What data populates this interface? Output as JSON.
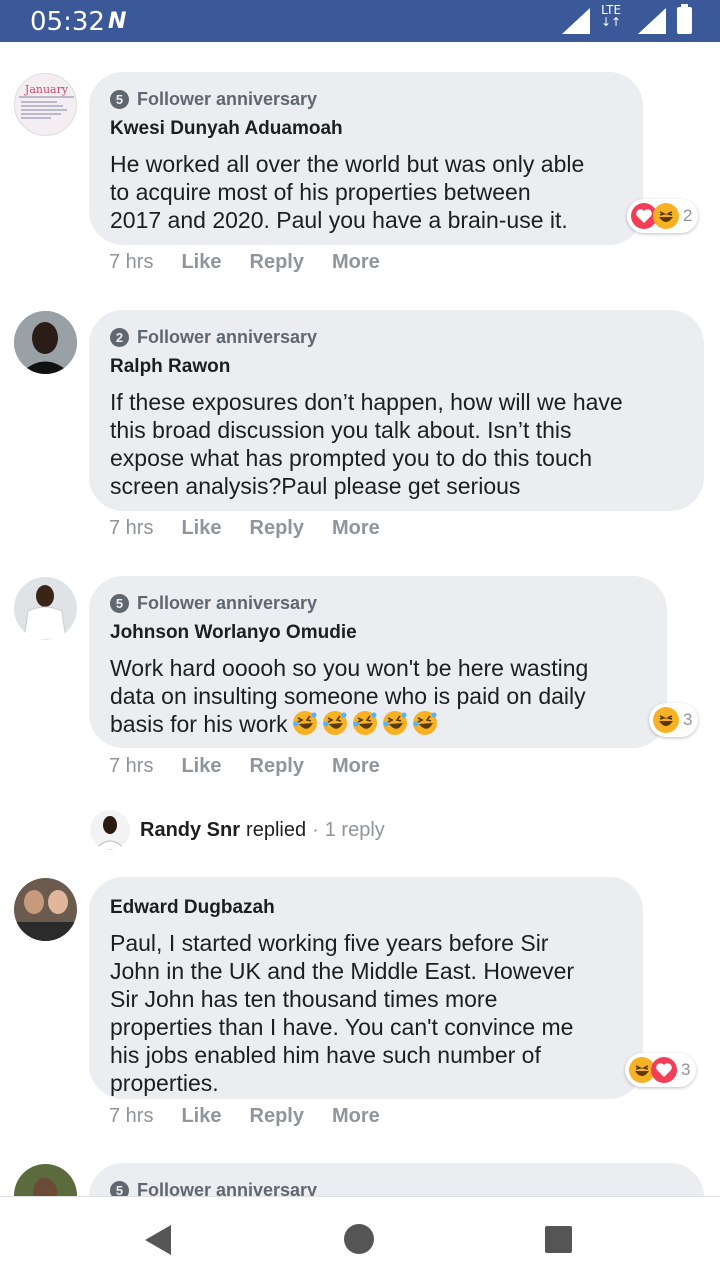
{
  "status_bar": {
    "time": "05:32",
    "network_label": "LTE",
    "icons": [
      "notification-n-icon",
      "signal-icon",
      "lte-icon",
      "signal-icon",
      "battery-icon"
    ]
  },
  "comments": [
    {
      "avatar": "calendar-image-avatar",
      "avatar_caption": "January",
      "badge_number": "5",
      "badge_label": "Follower anniversary",
      "author": "Kwesi Dunyah Aduamoah",
      "lines": [
        "He worked all over the world but was only able",
        "to acquire most of his properties between",
        "2017 and 2020. Paul you have a brain-use it."
      ],
      "reactions": [
        "heart",
        "haha"
      ],
      "reaction_count": "2",
      "time": "7 hrs",
      "actions": [
        "Like",
        "Reply",
        "More"
      ]
    },
    {
      "avatar": "man-portrait-avatar",
      "badge_number": "2",
      "badge_label": "Follower anniversary",
      "author": "Ralph Rawon",
      "lines": [
        "If these exposures don’t happen, how will we have",
        "this broad discussion you talk about. Isn’t this",
        "expose what has prompted you to do this touch",
        "screen analysis?Paul please get serious"
      ],
      "time": "7 hrs",
      "actions": [
        "Like",
        "Reply",
        "More"
      ]
    },
    {
      "avatar": "man-white-shirt-avatar",
      "badge_number": "5",
      "badge_label": "Follower anniversary",
      "author": "Johnson Worlanyo Omudie",
      "lines": [
        "Work hard ooooh so you won't be here wasting",
        "data on insulting someone who is paid on daily",
        "basis for his work"
      ],
      "trailing_emoji": "rolling-laughing-emoji",
      "trailing_emoji_count": 5,
      "reactions": [
        "haha"
      ],
      "reaction_count": "3",
      "time": "7 hrs",
      "actions": [
        "Like",
        "Reply",
        "More"
      ]
    },
    {
      "avatar": "group-photo-avatar",
      "author": "Edward Dugbazah",
      "lines": [
        "Paul, I started working five years before Sir",
        "John in the UK and the Middle East. However",
        "Sir John has ten thousand times more",
        "properties than I have. You can't convince me",
        "his jobs enabled him have such number of",
        "properties."
      ],
      "reactions": [
        "haha",
        "heart"
      ],
      "reaction_count": "3",
      "time": "7 hrs",
      "actions": [
        "Like",
        "Reply",
        "More"
      ]
    },
    {
      "avatar": "man-outdoor-avatar",
      "badge_number": "5",
      "badge_label": "Follower anniversary"
    }
  ],
  "reply_summary": {
    "name": "Randy Snr",
    "verb": "replied",
    "separator": "·",
    "count": "1 reply"
  },
  "nav_bar": {
    "buttons": [
      "back-icon",
      "home-icon",
      "recents-icon"
    ]
  }
}
